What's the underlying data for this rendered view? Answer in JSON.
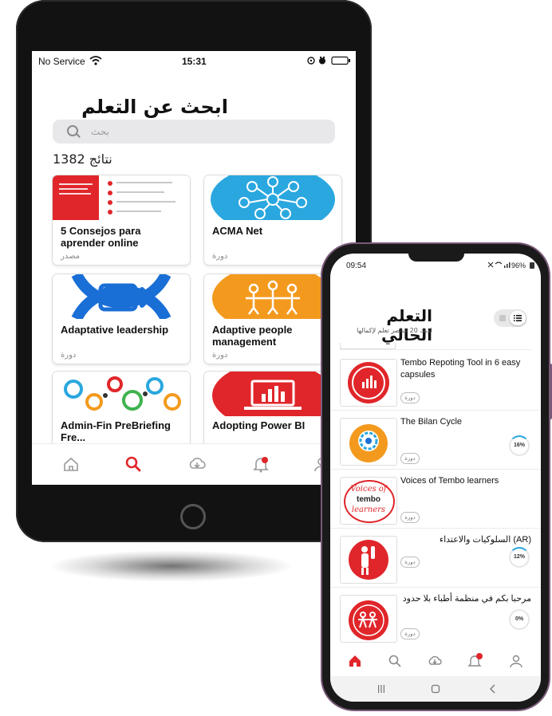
{
  "tablet": {
    "status": {
      "carrier": "No Service",
      "time": "15:31"
    },
    "title": "ابحث عن التعلم",
    "search_placeholder": "بحث",
    "results_label": "نتائج 1382",
    "cards": [
      {
        "title": "5 Consejos para aprender online",
        "type": "مصدر",
        "image": "consejos-thumb"
      },
      {
        "title": "ACMA Net",
        "type": "دورة",
        "image": "network-thumb"
      },
      {
        "title": "Adaptative leadership",
        "type": "دورة",
        "image": "exit-arrow-thumb"
      },
      {
        "title": "Adaptive people management",
        "type": "دورة",
        "image": "people-thumb"
      },
      {
        "title": "Admin-Fin PreBriefing Fre...",
        "type": "",
        "image": "gears-thumb"
      },
      {
        "title": "Adopting Power BI",
        "type": "",
        "image": "laptop-thumb"
      }
    ],
    "nav": [
      "home-icon",
      "search-icon",
      "download-icon",
      "bell-icon",
      "profile-icon"
    ],
    "notif_count": "",
    "accent": "#e0262a"
  },
  "phone": {
    "status": {
      "time": "09:54",
      "battery": "96%"
    },
    "title": "التعلم الحالي",
    "subtitle": "لديك 20 عناصر تعلم لإكمالها",
    "items": [
      {
        "name": "Tembo Repoting Tool in 6 easy capsules",
        "badge": "دورة",
        "progress": ""
      },
      {
        "name": "The Bilan Cycle",
        "badge": "دورة",
        "progress": "16%"
      },
      {
        "name": "Voices of Tembo learners",
        "badge": "دورة",
        "progress": ""
      },
      {
        "name": "السلوكيات والاعتداء (AR)",
        "badge": "دورة",
        "progress": "12%"
      },
      {
        "name": "مرحبا بكم في منظمة أطباء بلا حدود",
        "badge": "دورة",
        "progress": "0%"
      }
    ],
    "thumb_texts": {
      "voices": "Voices of",
      "tembo": "tembo",
      "learners": "learners",
      "bilan": "The Bilan Cycle"
    },
    "nav": [
      "home-icon",
      "search-icon",
      "download-icon",
      "bell-icon",
      "profile-icon"
    ],
    "accent": "#e0262a"
  }
}
